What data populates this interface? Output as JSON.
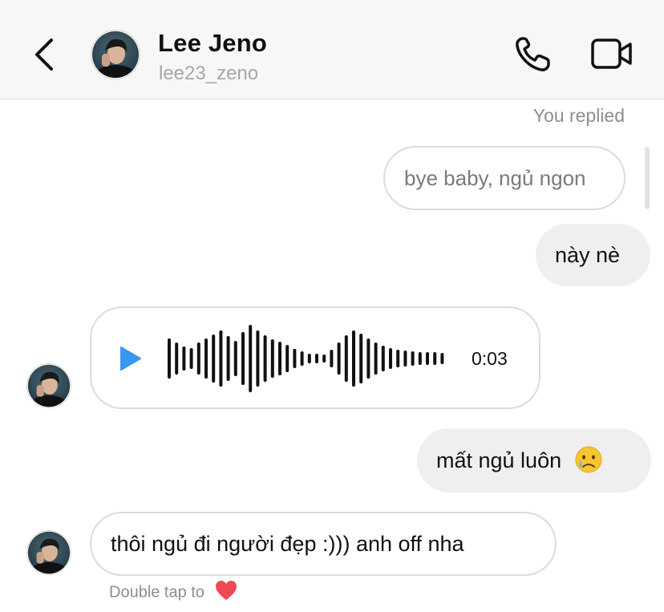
{
  "header": {
    "name": "Lee Jeno",
    "handle": "lee23_zeno",
    "back_icon": "chevron-left-icon",
    "call_icon": "phone-icon",
    "video_icon": "video-camera-icon"
  },
  "messages": {
    "you_replied_label": "You replied",
    "replied_to_text": "bye baby, ngủ ngon",
    "sent_1": "này nè",
    "voice_duration": "0:03",
    "sent_2": "mất ngủ luôn",
    "received_text": "thôi ngủ đi người đẹp :))) anh off nha",
    "double_tap_label": "Double tap to"
  },
  "colors": {
    "play_accent": "#3897f0",
    "header_bg": "#f7f7f7",
    "bubble_gray": "#efefef",
    "heart": "#ed4956"
  }
}
